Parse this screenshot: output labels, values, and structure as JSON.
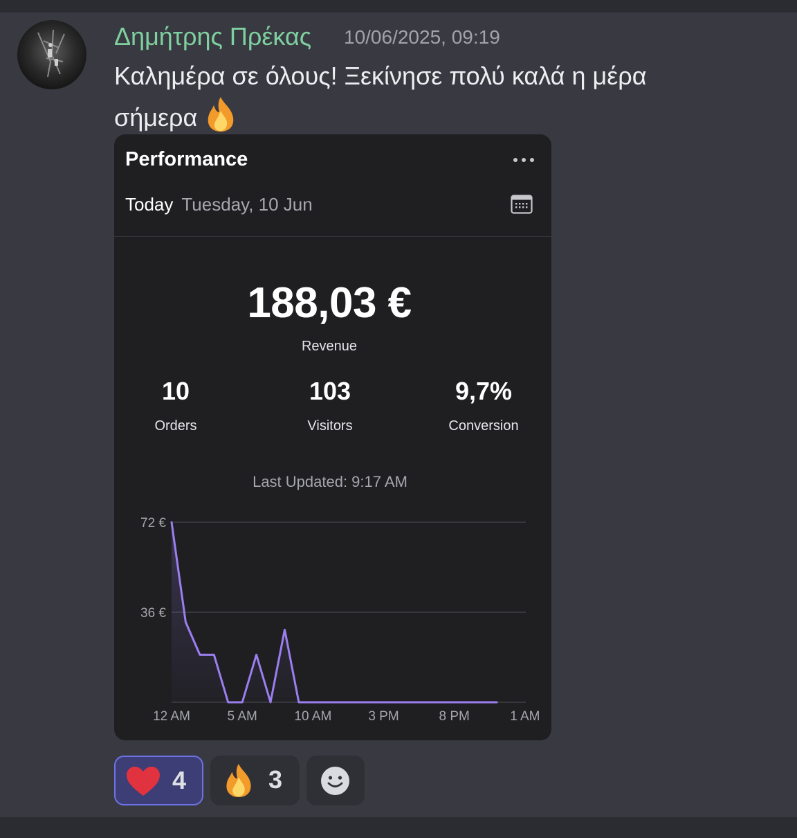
{
  "message": {
    "author": "Δημήτρης Πρέκας",
    "timestamp": "10/06/2025, 09:19",
    "text_line1": "Καλημέρα σε όλους! Ξεκίνησε πολύ καλά η μέρα",
    "text_line2": "σήμερα",
    "emoji": "fire-emoji",
    "author_color": "#7fd0a0"
  },
  "card": {
    "title": "Performance",
    "date_label": "Today",
    "date_value": "Tuesday, 10 Jun",
    "revenue": "188,03 €",
    "revenue_label": "Revenue",
    "stats": [
      {
        "value": "10",
        "label": "Orders"
      },
      {
        "value": "103",
        "label": "Visitors"
      },
      {
        "value": "9,7%",
        "label": "Conversion"
      }
    ],
    "last_updated": "Last Updated: 9:17 AM"
  },
  "chart_data": {
    "type": "area",
    "x": [
      0,
      1,
      2,
      3,
      4,
      5,
      6,
      7,
      8,
      9,
      10,
      11,
      12,
      13,
      14,
      15,
      16,
      17,
      18,
      19,
      20,
      21,
      22,
      23
    ],
    "values": [
      72,
      32,
      19,
      19,
      0,
      0,
      19,
      0,
      29,
      0,
      0,
      0,
      0,
      0,
      0,
      0,
      0,
      0,
      0,
      0,
      0,
      0,
      0,
      0
    ],
    "y_ticks": [
      "72 €",
      "36 €"
    ],
    "x_ticks": [
      "12 AM",
      "5 AM",
      "10 AM",
      "3 PM",
      "8 PM",
      "1 AM"
    ],
    "ylim": [
      0,
      72
    ],
    "line_color": "#9b7ff0",
    "grid": true
  },
  "reactions": [
    {
      "icon": "heart-emoji",
      "count": "4",
      "selected": true
    },
    {
      "icon": "fire-emoji",
      "count": "3",
      "selected": false
    }
  ],
  "add_reaction_icon": "smiley-icon"
}
